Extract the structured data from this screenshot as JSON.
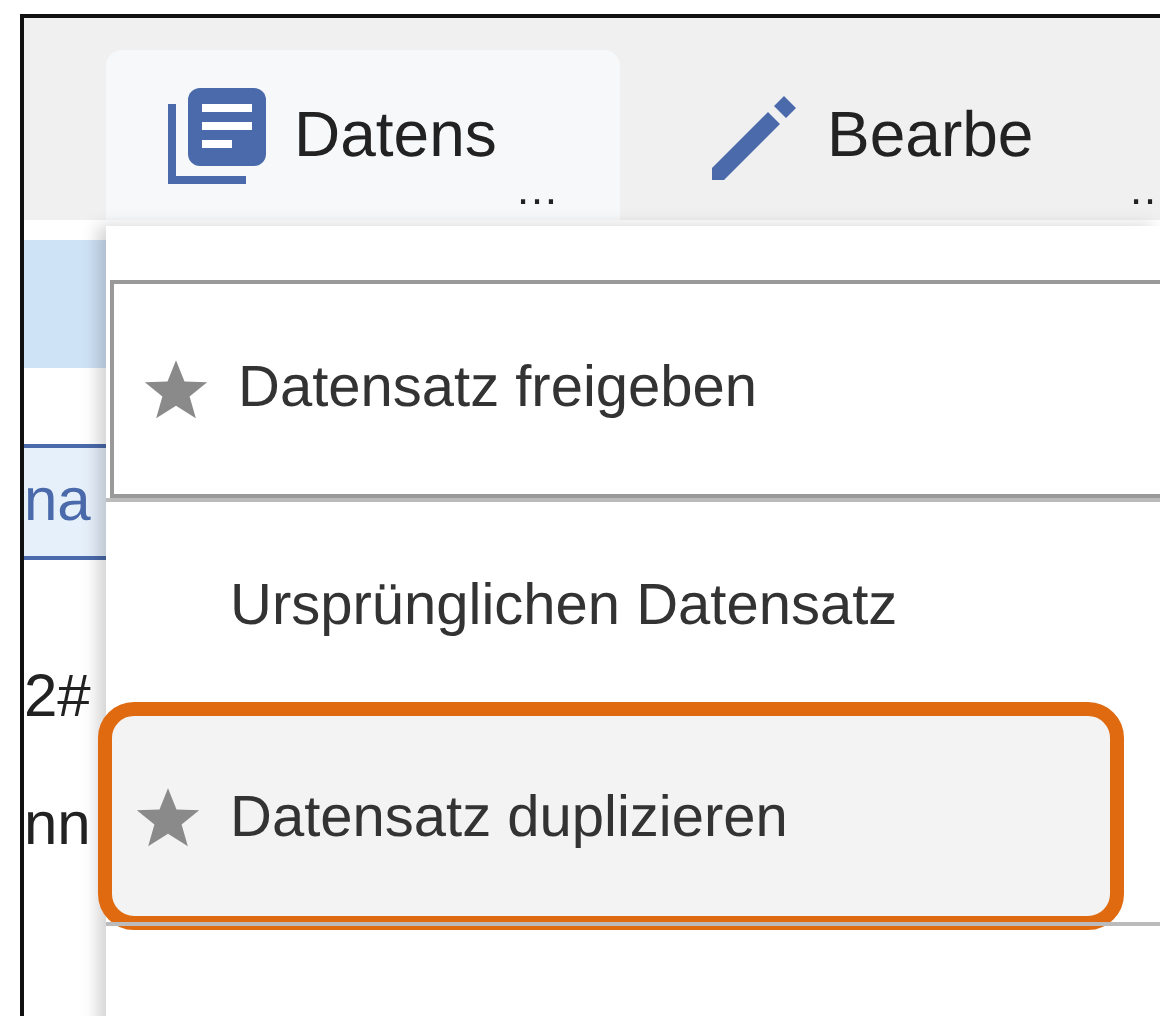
{
  "toolbar": {
    "buttons": [
      {
        "kind": "document",
        "label": "Datens",
        "overflow_mark": "…",
        "selected": true
      },
      {
        "kind": "pencil",
        "label": "Bearbe",
        "overflow_mark": "…",
        "selected": false
      }
    ]
  },
  "background_table": {
    "rows": [
      {
        "kind": "header"
      },
      {
        "kind": "link",
        "text": "na"
      },
      {
        "kind": "plain",
        "text": "2#"
      },
      {
        "kind": "plain",
        "text": "nn"
      }
    ]
  },
  "menu": {
    "items": [
      {
        "label": "Datensatz freigeben",
        "starred": true,
        "focused": true,
        "highlighted": false
      },
      {
        "label": "Ursprünglichen Datensatz",
        "starred": false,
        "focused": false,
        "highlighted": false
      },
      {
        "label": "Datensatz duplizieren",
        "starred": true,
        "focused": false,
        "highlighted": true
      },
      {
        "starred": false,
        "focused": false,
        "highlighted": false
      }
    ]
  }
}
